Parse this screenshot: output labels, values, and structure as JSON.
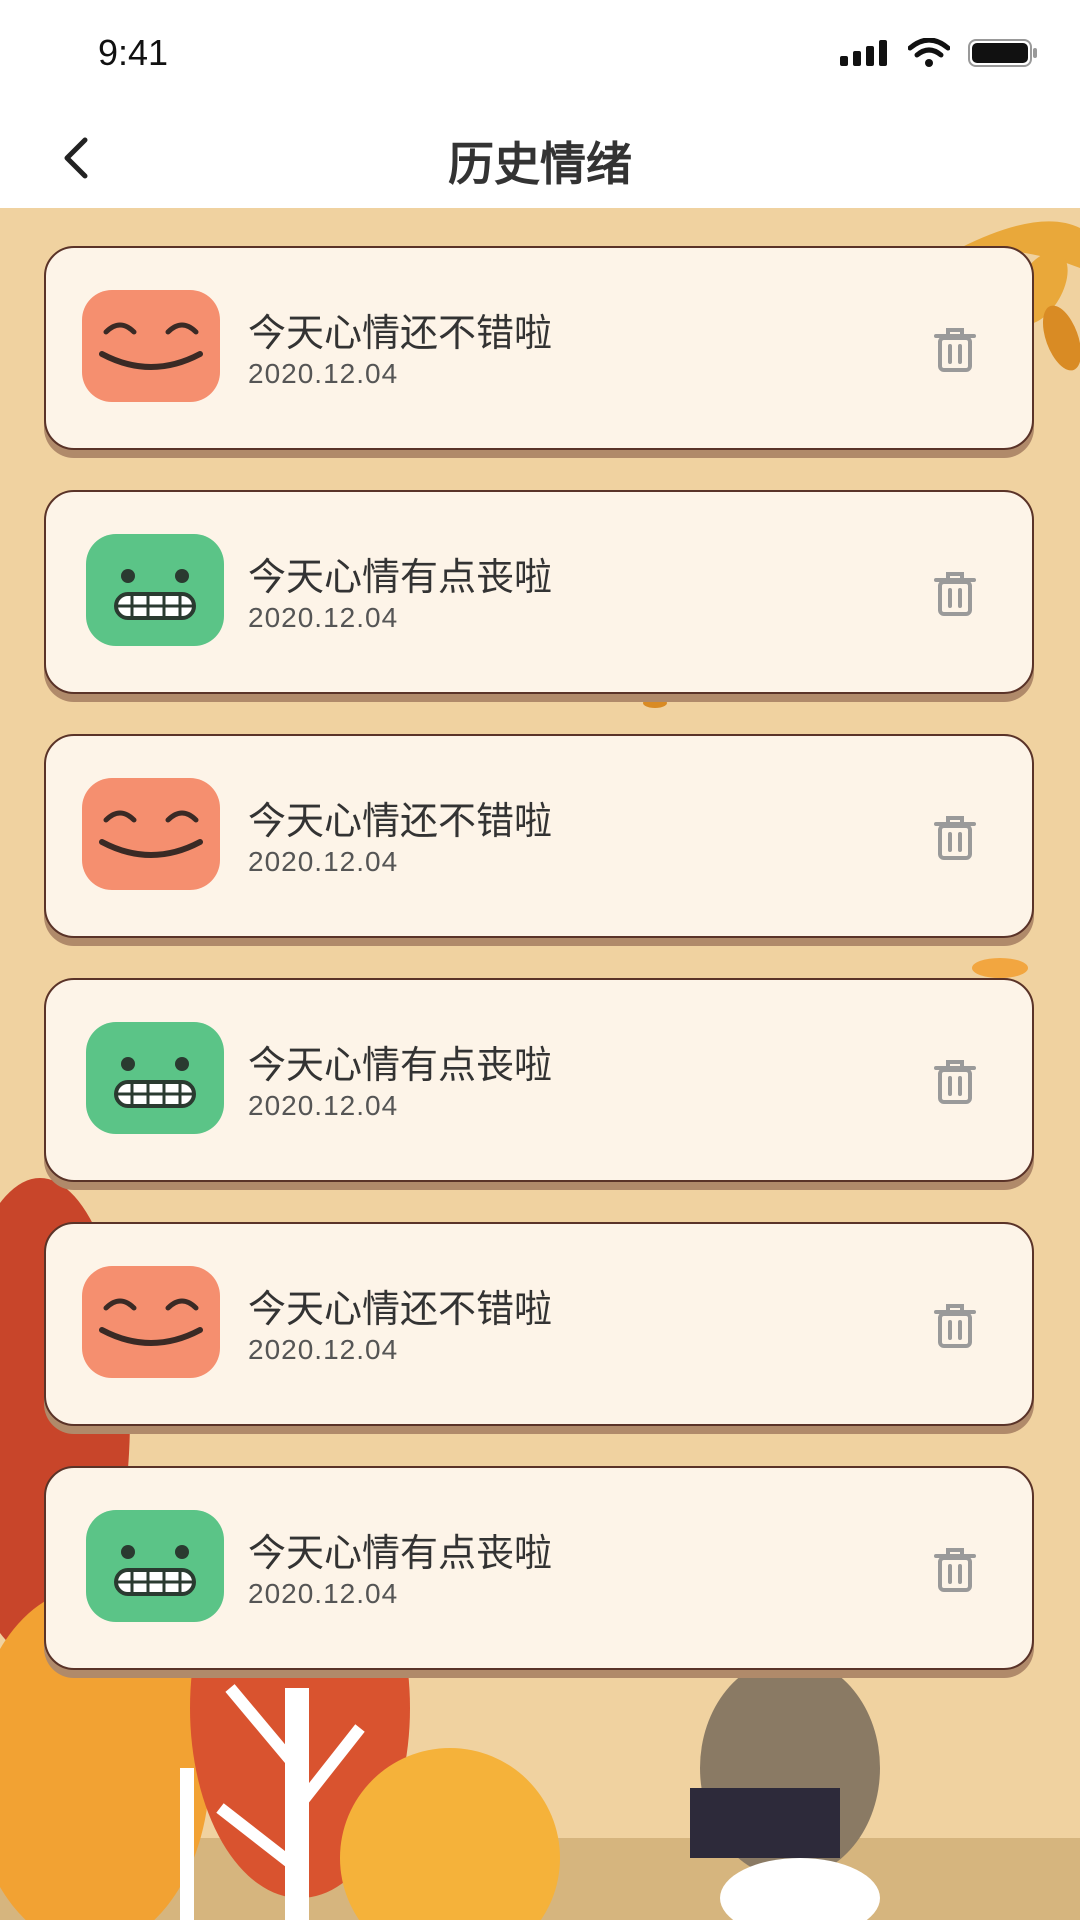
{
  "status_bar": {
    "time": "9:41",
    "icons": [
      "signal-icon",
      "wifi-icon",
      "battery-icon"
    ]
  },
  "header": {
    "title": "历史情绪",
    "back_icon": "back-chevron-icon"
  },
  "colors": {
    "happy_face": "#f58f6f",
    "sad_face": "#5bc487",
    "card_bg": "#fdf4e8",
    "card_border": "#5a3328",
    "page_bg": "#f0d2a0"
  },
  "entries": [
    {
      "mood": "happy",
      "text": "今天心情还不错啦",
      "date": "2020.12.04"
    },
    {
      "mood": "sad",
      "text": "今天心情有点丧啦",
      "date": "2020.12.04"
    },
    {
      "mood": "happy",
      "text": "今天心情还不错啦",
      "date": "2020.12.04"
    },
    {
      "mood": "sad",
      "text": "今天心情有点丧啦",
      "date": "2020.12.04"
    },
    {
      "mood": "happy",
      "text": "今天心情还不错啦",
      "date": "2020.12.04"
    },
    {
      "mood": "sad",
      "text": "今天心情有点丧啦",
      "date": "2020.12.04"
    }
  ]
}
